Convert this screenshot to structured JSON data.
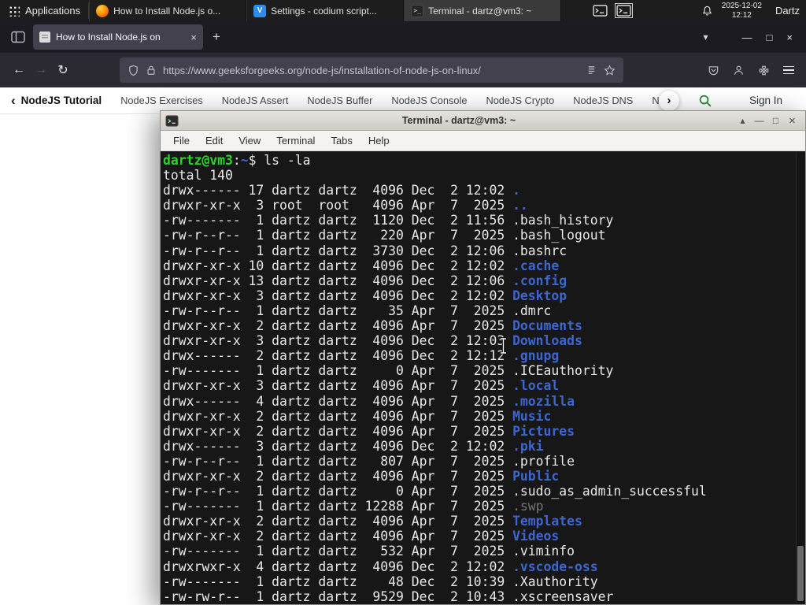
{
  "colors": {
    "accent-green": "#2f8d46",
    "term-bg": "#171717",
    "term-fg": "#e9e9e9",
    "dir-blue": "#3d66d0",
    "prompt-green": "#2ad52a",
    "dim-gray": "#767676",
    "ff-dark": "#1c1b22",
    "ff-toolbar": "#2b2a33",
    "ff-field": "#42414d"
  },
  "icons": {
    "back": "←",
    "forward": "→",
    "reload": "↻",
    "close": "×",
    "minimize": "—",
    "maximize": "□",
    "plus": "+",
    "chevron_down": "▾",
    "shade": "▴",
    "chevron_left": "‹",
    "chevron_right": "›"
  },
  "panel": {
    "applications_label": "Applications",
    "tasks": [
      {
        "label": "How to Install Node.js o...",
        "icon": "firefox-icon"
      },
      {
        "label": "Settings - codium script...",
        "icon": "codium-icon"
      },
      {
        "label": "Terminal - dartz@vm3: ~",
        "icon": "terminal-icon"
      }
    ],
    "clock_date": "2025-12-02",
    "clock_time": "12:12",
    "user_label": "Dartz"
  },
  "browser": {
    "tab_title": "How to Install Node.js on",
    "url": "https://www.geeksforgeeks.org/node-js/installation-of-node-js-on-linux/",
    "site_nav": {
      "active": "NodeJS Tutorial",
      "links": [
        "NodeJS Exercises",
        "NodeJS Assert",
        "NodeJS Buffer",
        "NodeJS Console",
        "NodeJS Crypto",
        "NodeJS DNS",
        "Node"
      ],
      "sign_in": "Sign In"
    }
  },
  "terminal": {
    "window_title": "Terminal - dartz@vm3: ~",
    "menus": [
      "File",
      "Edit",
      "View",
      "Terminal",
      "Tabs",
      "Help"
    ],
    "prompt": {
      "userhost": "dartz@vm3",
      "path": "~",
      "command": "ls -la"
    },
    "total_line": "total 140",
    "listing": [
      [
        "drwx------",
        17,
        "dartz",
        "dartz",
        4096,
        "Dec",
        2,
        "12:02",
        ".",
        "dir"
      ],
      [
        "drwxr-xr-x",
        3,
        "root",
        "root",
        4096,
        "Apr",
        7,
        "2025",
        "..",
        "dir"
      ],
      [
        "-rw-------",
        1,
        "dartz",
        "dartz",
        1120,
        "Dec",
        2,
        "11:56",
        ".bash_history",
        "file"
      ],
      [
        "-rw-r--r--",
        1,
        "dartz",
        "dartz",
        220,
        "Apr",
        7,
        "2025",
        ".bash_logout",
        "file"
      ],
      [
        "-rw-r--r--",
        1,
        "dartz",
        "dartz",
        3730,
        "Dec",
        2,
        "12:06",
        ".bashrc",
        "file"
      ],
      [
        "drwxr-xr-x",
        10,
        "dartz",
        "dartz",
        4096,
        "Dec",
        2,
        "12:02",
        ".cache",
        "dir"
      ],
      [
        "drwxr-xr-x",
        13,
        "dartz",
        "dartz",
        4096,
        "Dec",
        2,
        "12:06",
        ".config",
        "dir"
      ],
      [
        "drwxr-xr-x",
        3,
        "dartz",
        "dartz",
        4096,
        "Dec",
        2,
        "12:02",
        "Desktop",
        "dir"
      ],
      [
        "-rw-r--r--",
        1,
        "dartz",
        "dartz",
        35,
        "Apr",
        7,
        "2025",
        ".dmrc",
        "file"
      ],
      [
        "drwxr-xr-x",
        2,
        "dartz",
        "dartz",
        4096,
        "Apr",
        7,
        "2025",
        "Documents",
        "dir"
      ],
      [
        "drwxr-xr-x",
        3,
        "dartz",
        "dartz",
        4096,
        "Dec",
        2,
        "12:03",
        "Downloads",
        "dir"
      ],
      [
        "drwx------",
        2,
        "dartz",
        "dartz",
        4096,
        "Dec",
        2,
        "12:12",
        ".gnupg",
        "dir"
      ],
      [
        "-rw-------",
        1,
        "dartz",
        "dartz",
        0,
        "Apr",
        7,
        "2025",
        ".ICEauthority",
        "file"
      ],
      [
        "drwxr-xr-x",
        3,
        "dartz",
        "dartz",
        4096,
        "Apr",
        7,
        "2025",
        ".local",
        "dir"
      ],
      [
        "drwx------",
        4,
        "dartz",
        "dartz",
        4096,
        "Apr",
        7,
        "2025",
        ".mozilla",
        "dir"
      ],
      [
        "drwxr-xr-x",
        2,
        "dartz",
        "dartz",
        4096,
        "Apr",
        7,
        "2025",
        "Music",
        "dir"
      ],
      [
        "drwxr-xr-x",
        2,
        "dartz",
        "dartz",
        4096,
        "Apr",
        7,
        "2025",
        "Pictures",
        "dir"
      ],
      [
        "drwx------",
        3,
        "dartz",
        "dartz",
        4096,
        "Dec",
        2,
        "12:02",
        ".pki",
        "dir"
      ],
      [
        "-rw-r--r--",
        1,
        "dartz",
        "dartz",
        807,
        "Apr",
        7,
        "2025",
        ".profile",
        "file"
      ],
      [
        "drwxr-xr-x",
        2,
        "dartz",
        "dartz",
        4096,
        "Apr",
        7,
        "2025",
        "Public",
        "dir"
      ],
      [
        "-rw-r--r--",
        1,
        "dartz",
        "dartz",
        0,
        "Apr",
        7,
        "2025",
        ".sudo_as_admin_successful",
        "file"
      ],
      [
        "-rw-------",
        1,
        "dartz",
        "dartz",
        12288,
        "Apr",
        7,
        "2025",
        ".swp",
        "dim"
      ],
      [
        "drwxr-xr-x",
        2,
        "dartz",
        "dartz",
        4096,
        "Apr",
        7,
        "2025",
        "Templates",
        "dir"
      ],
      [
        "drwxr-xr-x",
        2,
        "dartz",
        "dartz",
        4096,
        "Apr",
        7,
        "2025",
        "Videos",
        "dir"
      ],
      [
        "-rw-------",
        1,
        "dartz",
        "dartz",
        532,
        "Apr",
        7,
        "2025",
        ".viminfo",
        "file"
      ],
      [
        "drwxrwxr-x",
        4,
        "dartz",
        "dartz",
        4096,
        "Dec",
        2,
        "12:02",
        ".vscode-oss",
        "dir"
      ],
      [
        "-rw-------",
        1,
        "dartz",
        "dartz",
        48,
        "Dec",
        2,
        "10:39",
        ".Xauthority",
        "file"
      ],
      [
        "-rw-rw-r--",
        1,
        "dartz",
        "dartz",
        9529,
        "Dec",
        2,
        "10:43",
        ".xscreensaver",
        "file"
      ]
    ]
  }
}
